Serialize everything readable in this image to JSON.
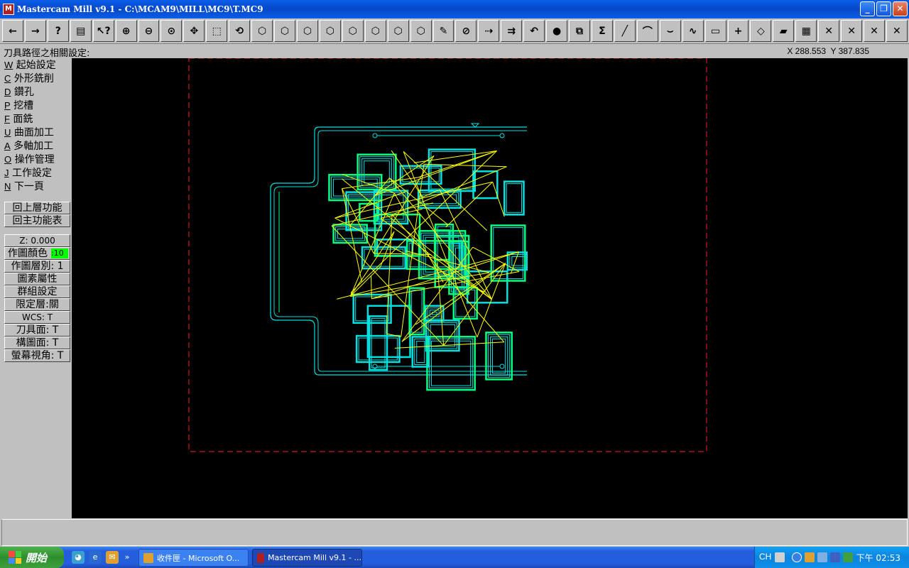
{
  "window": {
    "title": "Mastercam Mill v9.1 - C:\\MCAM9\\MILL\\MC9\\T.MC9",
    "icon_name": "mastercam-app-icon"
  },
  "toolbar": {
    "buttons": [
      {
        "name": "back-arrow-icon",
        "glyph": "←"
      },
      {
        "name": "forward-arrow-icon",
        "glyph": "→"
      },
      {
        "name": "help-icon",
        "glyph": "?"
      },
      {
        "name": "calculator-icon",
        "glyph": "▤"
      },
      {
        "name": "analyze-icon",
        "glyph": "↖?"
      },
      {
        "name": "zoom-window-icon",
        "glyph": "⊕"
      },
      {
        "name": "zoom-out-icon",
        "glyph": "⊖"
      },
      {
        "name": "zoom-fit-icon",
        "glyph": "⊙"
      },
      {
        "name": "pan-icon",
        "glyph": "✥"
      },
      {
        "name": "zoom-select-icon",
        "glyph": "⬚"
      },
      {
        "name": "rotate-view-icon",
        "glyph": "⟲"
      },
      {
        "name": "view-top-icon",
        "glyph": "⬡"
      },
      {
        "name": "view-front-icon",
        "glyph": "⬡"
      },
      {
        "name": "view-side-icon",
        "glyph": "⬡"
      },
      {
        "name": "view-iso-icon",
        "glyph": "⬡"
      },
      {
        "name": "cplane-top-icon",
        "glyph": "⬡"
      },
      {
        "name": "cplane-front-icon",
        "glyph": "⬡"
      },
      {
        "name": "cplane-side-icon",
        "glyph": "⬡"
      },
      {
        "name": "cplane-3d-icon",
        "glyph": "⬡"
      },
      {
        "name": "screen-clear-icon",
        "glyph": "✎"
      },
      {
        "name": "delete-icon",
        "glyph": "⊘"
      },
      {
        "name": "translate-icon",
        "glyph": "⇢"
      },
      {
        "name": "color-change-icon",
        "glyph": "⇉"
      },
      {
        "name": "undo-icon",
        "glyph": "↶"
      },
      {
        "name": "shade-sphere-icon",
        "glyph": "●"
      },
      {
        "name": "xform-icon",
        "glyph": "⧉"
      },
      {
        "name": "sum-icon",
        "glyph": "Σ"
      },
      {
        "name": "line-icon",
        "glyph": "╱"
      },
      {
        "name": "arc-icon",
        "glyph": "⌒"
      },
      {
        "name": "fillet-icon",
        "glyph": "⌣"
      },
      {
        "name": "spline-icon",
        "glyph": "∿"
      },
      {
        "name": "rectangle-icon",
        "glyph": "▭"
      },
      {
        "name": "point-icon",
        "glyph": "+"
      },
      {
        "name": "surface-icon",
        "glyph": "◇"
      },
      {
        "name": "solid-icon",
        "glyph": "▰"
      },
      {
        "name": "operations-icon",
        "glyph": "▦"
      },
      {
        "name": "trim-1-icon",
        "glyph": "✕"
      },
      {
        "name": "trim-2-icon",
        "glyph": "✕"
      },
      {
        "name": "trim-3-icon",
        "glyph": "✕"
      },
      {
        "name": "trim-4-icon",
        "glyph": "✕"
      }
    ]
  },
  "prompt": "刀具路徑之相關設定:",
  "coords": {
    "x": "X 288.553",
    "y": "Y 387.835"
  },
  "menu": {
    "items": [
      {
        "key": "W",
        "label": "起始設定"
      },
      {
        "key": "C",
        "label": "外形銑削"
      },
      {
        "key": "D",
        "label": "鑽孔"
      },
      {
        "key": "P",
        "label": "挖槽"
      },
      {
        "key": "F",
        "label": "面銑"
      },
      {
        "key": "U",
        "label": "曲面加工"
      },
      {
        "key": "A",
        "label": "多軸加工"
      },
      {
        "key": "O",
        "label": "操作管理"
      },
      {
        "key": "J",
        "label": "工作設定"
      },
      {
        "key": "N",
        "label": "下一頁"
      }
    ],
    "back_label": "回上層功能",
    "main_label": "回主功能表"
  },
  "settings": {
    "z": "Z:   0.000",
    "color_label": "作圖顏色",
    "color_value": ":10",
    "color_swatch": "#00ff00",
    "level": "作圖層別:  1",
    "attributes": "圖素屬性",
    "groups": "群組設定",
    "mask": "限定層:關",
    "wcs": "WCS:   T",
    "tplane": "刀具面:  T",
    "cplane": "構圖面:  T",
    "gview": "螢幕視角:  T"
  },
  "taskbar": {
    "start_label": "開始",
    "tasks": [
      {
        "label": "收件匣 - Microsoft O...",
        "state": "inactive"
      },
      {
        "label": "Mastercam Mill v9.1 - ...",
        "state": "active"
      }
    ],
    "language": "CH",
    "clock": "下午 02:53"
  },
  "colors": {
    "toolpath": "#00e0e0",
    "rapid": "#ffff00",
    "boundary": "#ff2020",
    "geometry": "#00ff80"
  }
}
